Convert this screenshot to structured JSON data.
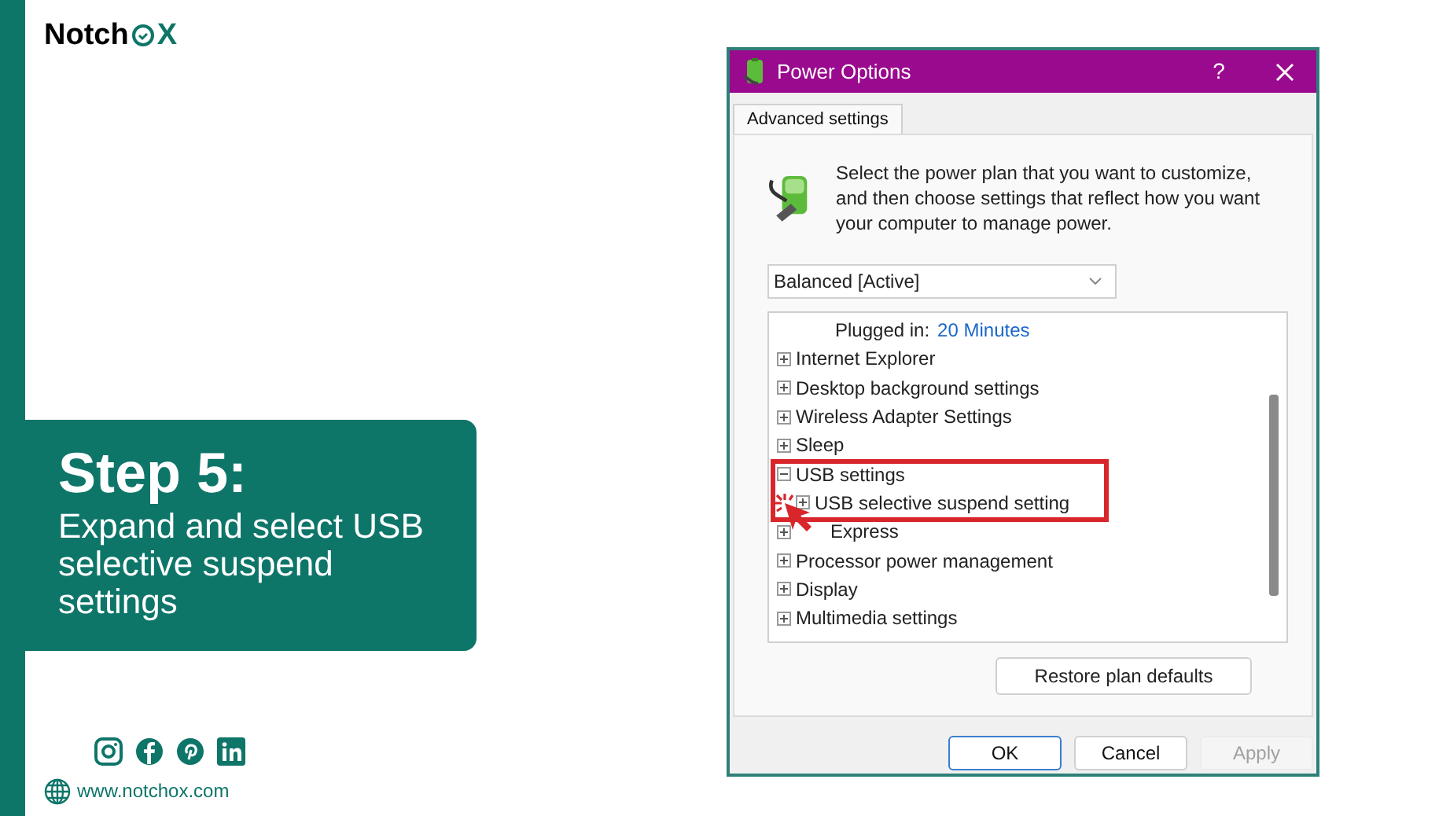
{
  "brand": {
    "name_start": "Notch",
    "name_end": "X"
  },
  "step": {
    "title": "Step 5:",
    "text": "Expand and select USB selective suspend settings"
  },
  "footer": {
    "website": "www.notchox.com"
  },
  "window": {
    "title": "Power Options",
    "help": "?"
  },
  "tabs": [
    {
      "label": "Advanced settings",
      "selected": true
    }
  ],
  "intro": "Select the power plan that you want to customize, and then choose settings that reflect how you want your computer to manage power.",
  "plan_select": {
    "value": "Balanced [Active]"
  },
  "tree": [
    {
      "kind": "setting",
      "label": "Plugged in:",
      "value": "20 Minutes"
    },
    {
      "kind": "group",
      "label": "Internet Explorer",
      "expanded": false
    },
    {
      "kind": "group",
      "label": "Desktop background settings",
      "expanded": false
    },
    {
      "kind": "group",
      "label": "Wireless Adapter Settings",
      "expanded": false
    },
    {
      "kind": "group",
      "label": "Sleep",
      "expanded": false
    },
    {
      "kind": "group",
      "label": "USB settings",
      "expanded": true,
      "children": [
        {
          "kind": "group",
          "label": "USB selective suspend setting",
          "expanded": false
        }
      ]
    },
    {
      "kind": "group",
      "label": "Express",
      "expanded": false
    },
    {
      "kind": "group",
      "label": "Processor power management",
      "expanded": false
    },
    {
      "kind": "group",
      "label": "Display",
      "expanded": false
    },
    {
      "kind": "group",
      "label": "Multimedia settings",
      "expanded": false
    }
  ],
  "restore_button": "Restore plan defaults",
  "buttons": [
    {
      "label": "OK",
      "default": true,
      "disabled": false
    },
    {
      "label": "Cancel",
      "default": false,
      "disabled": false
    },
    {
      "label": "Apply",
      "default": false,
      "disabled": true
    }
  ]
}
